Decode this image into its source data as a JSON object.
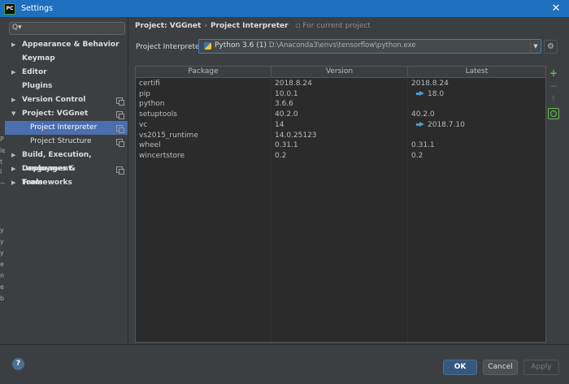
{
  "window": {
    "title": "Settings",
    "app_icon": "PC",
    "close_label": "✕"
  },
  "background_window_fragments": [
    "P",
    "le",
    "t",
    "l",
    "—",
    "y",
    "y",
    "y",
    "e",
    "n",
    "e",
    "b"
  ],
  "search": {
    "placeholder": "Q▾",
    "value": ""
  },
  "sidebar": {
    "items": [
      {
        "label": "Appearance & Behavior",
        "arrow": "▶",
        "copy": false
      },
      {
        "label": "Keymap",
        "arrow": "",
        "copy": false
      },
      {
        "label": "Editor",
        "arrow": "▶",
        "copy": false
      },
      {
        "label": "Plugins",
        "arrow": "",
        "copy": false
      },
      {
        "label": "Version Control",
        "arrow": "▶",
        "copy": true
      },
      {
        "label": "Project: VGGnet",
        "arrow": "▼",
        "copy": true
      },
      {
        "label": "Project Interpreter",
        "arrow": "",
        "copy": true,
        "selected": true
      },
      {
        "label": "Project Structure",
        "arrow": "",
        "copy": true
      },
      {
        "label": "Build, Execution, Deployment",
        "arrow": "▶",
        "copy": false
      },
      {
        "label": "Languages & Frameworks",
        "arrow": "▶",
        "copy": true
      },
      {
        "label": "Tools",
        "arrow": "▶",
        "copy": false
      }
    ]
  },
  "breadcrumb": {
    "project": "Project: VGGnet",
    "separator": "›",
    "page": "Project Interpreter",
    "note": "For current project"
  },
  "interpreter": {
    "label": "Project Interpreter:",
    "name": "Python 3.6 (1)",
    "path": "D:\\Anaconda3\\envs\\tensorflow\\python.exe"
  },
  "table": {
    "headers": [
      "Package",
      "Version",
      "Latest"
    ],
    "rows": [
      {
        "package": "certifi",
        "version": "2018.8.24",
        "latest": "2018.8.24",
        "upgrade": false
      },
      {
        "package": "pip",
        "version": "10.0.1",
        "latest": "18.0",
        "upgrade": true
      },
      {
        "package": "python",
        "version": "3.6.6",
        "latest": "",
        "upgrade": false
      },
      {
        "package": "setuptools",
        "version": "40.2.0",
        "latest": "40.2.0",
        "upgrade": false
      },
      {
        "package": "vc",
        "version": "14",
        "latest": "2018.7.10",
        "upgrade": true
      },
      {
        "package": "vs2015_runtime",
        "version": "14.0.25123",
        "latest": "",
        "upgrade": false
      },
      {
        "package": "wheel",
        "version": "0.31.1",
        "latest": "0.31.1",
        "upgrade": false
      },
      {
        "package": "wincertstore",
        "version": "0.2",
        "latest": "0.2",
        "upgrade": false
      }
    ]
  },
  "tools": {
    "add": "+",
    "remove": "−",
    "upgrade": "⇧"
  },
  "buttons": {
    "help": "?",
    "ok": "OK",
    "cancel": "Cancel",
    "apply": "Apply"
  },
  "colors": {
    "accent": "#4b6eaf",
    "titlebar": "#1e6fbd",
    "add_green": "#5fb84a",
    "upgrade_blue": "#4a9bd9"
  }
}
